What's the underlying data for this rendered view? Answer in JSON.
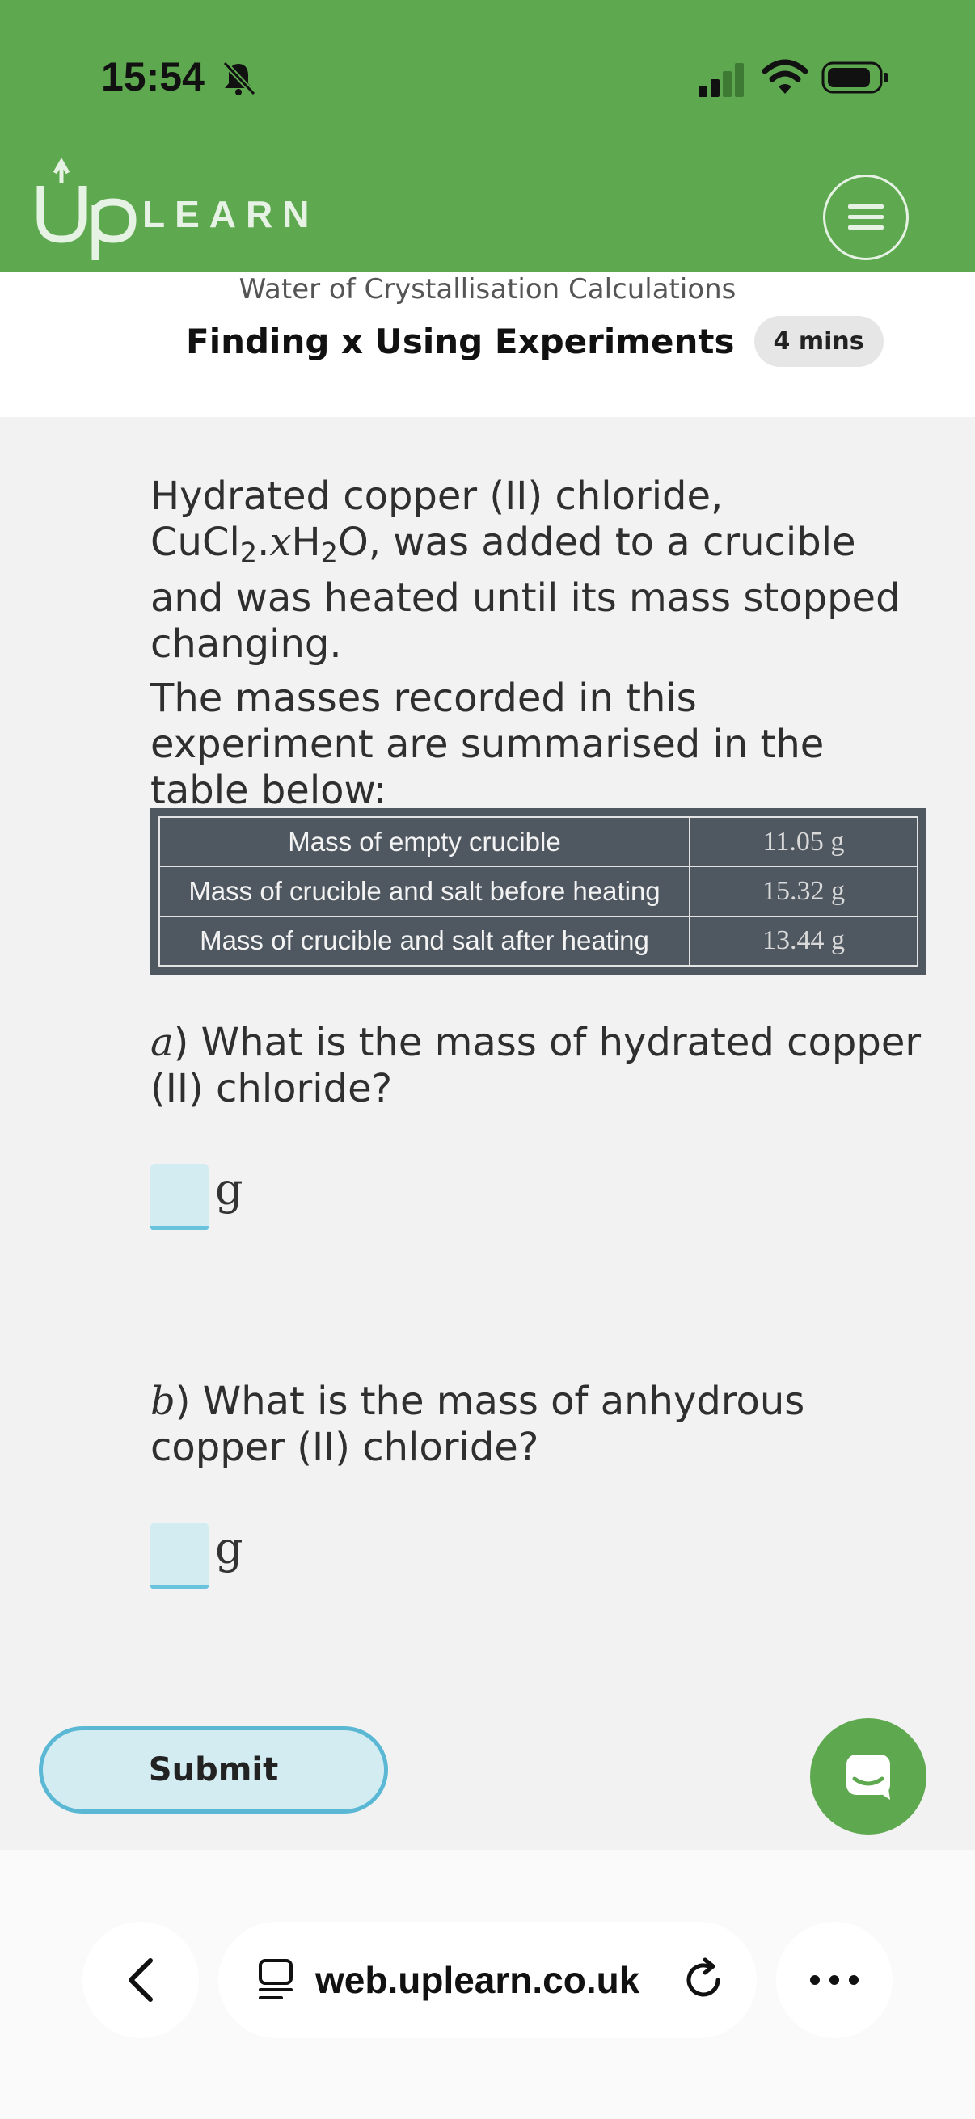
{
  "status_bar": {
    "time": "15:54"
  },
  "header": {
    "brand_text": "LEARN",
    "topic_title": "Water of Crystallisation Calculations",
    "lesson_title": "Finding x Using Experiments",
    "duration_badge": "4 mins",
    "brand_color": "#5ea94f"
  },
  "question": {
    "intro_part1": "Hydrated copper (II) chloride, CuCl",
    "intro_sub1": "2",
    "intro_dot": ".",
    "intro_var": "x",
    "intro_h": "H",
    "intro_sub2": "2",
    "intro_part2": "O, was added to a crucible and was heated until its mass stopped changing.",
    "table_intro": "The masses recorded in this experiment are summarised in the table below:",
    "table": {
      "rows": [
        {
          "label": "Mass of empty crucible",
          "value": "11.05 g"
        },
        {
          "label": "Mass of crucible and salt before heating",
          "value": "15.32 g"
        },
        {
          "label": "Mass of crucible and salt after heating",
          "value": "13.44 g"
        }
      ]
    },
    "part_a": {
      "letter": "a",
      "paren": ")",
      "text": " What is the mass of hydrated copper (II) chloride?",
      "unit": "g"
    },
    "part_b": {
      "letter": "b",
      "paren": ")",
      "text": " What is the mass of anhydrous copper (II) chloride?",
      "unit": "g"
    }
  },
  "actions": {
    "submit_label": "Submit"
  },
  "browser": {
    "url": "web.uplearn.co.uk"
  }
}
